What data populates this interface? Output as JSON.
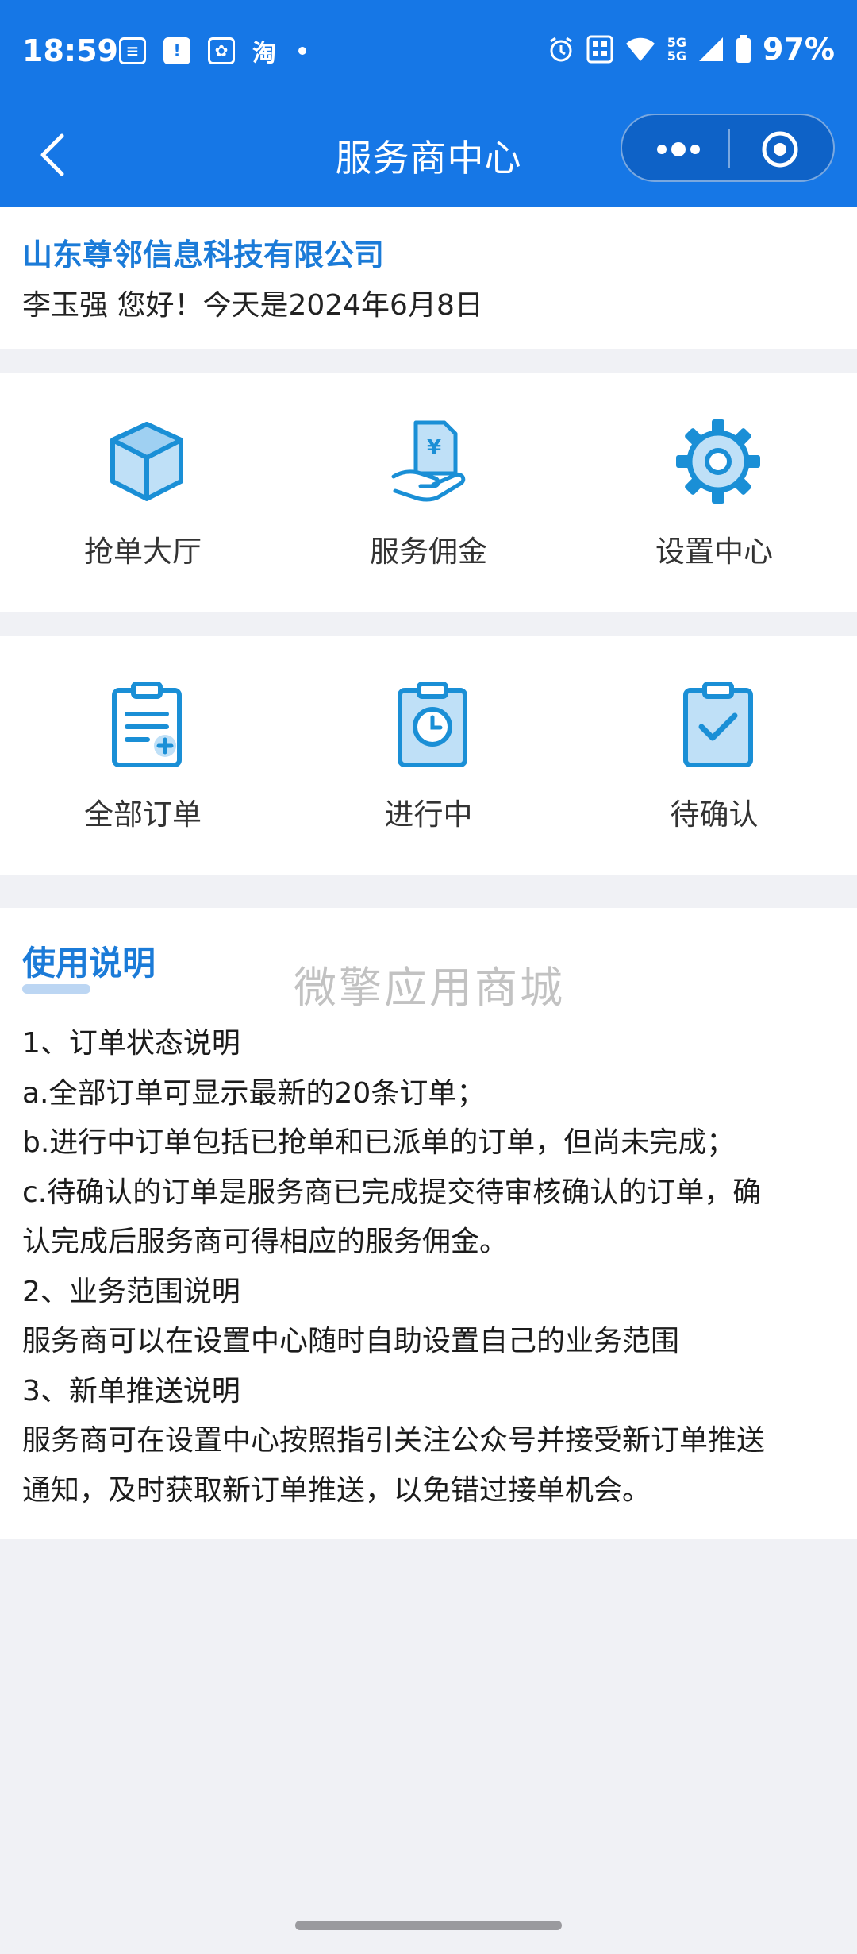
{
  "status_bar": {
    "time": "18:59",
    "left_icons": [
      "notes-icon",
      "alert-icon",
      "baidu-icon",
      "taobao-icon"
    ],
    "taobao_label": "淘",
    "network_label_1": "5G",
    "network_label_2": "5G",
    "battery": "97%"
  },
  "nav": {
    "title": "服务商中心",
    "bg_color": "#1677e6"
  },
  "company": {
    "name": "山东尊邻信息科技有限公司",
    "greeting": "李玉强 您好！今天是2024年6月8日"
  },
  "menu_row1": [
    {
      "label": "抢单大厅",
      "icon": "box-icon"
    },
    {
      "label": "服务佣金",
      "icon": "commission-hand-icon"
    },
    {
      "label": "设置中心",
      "icon": "gear-icon"
    }
  ],
  "menu_row2": [
    {
      "label": "全部订单",
      "icon": "order-list-icon"
    },
    {
      "label": "进行中",
      "icon": "clock-clipboard-icon"
    },
    {
      "label": "待确认",
      "icon": "check-clipboard-icon"
    }
  ],
  "help": {
    "title": "使用说明",
    "watermark": "微擎应用商城",
    "lines": [
      "1、订单状态说明",
      "a.全部订单可显示最新的20条订单；",
      "b.进行中订单包括已抢单和已派单的订单，但尚未完成；",
      "c.待确认的订单是服务商已完成提交待审核确认的订单，确",
      "认完成后服务商可得相应的服务佣金。",
      "2、业务范围说明",
      "服务商可以在设置中心随时自助设置自己的业务范围",
      "3、新单推送说明",
      "服务商可在设置中心按照指引关注公众号并接受新订单推送",
      "通知，及时获取新订单推送，以免错过接单机会。"
    ]
  },
  "accent_color": "#1b7bd8"
}
